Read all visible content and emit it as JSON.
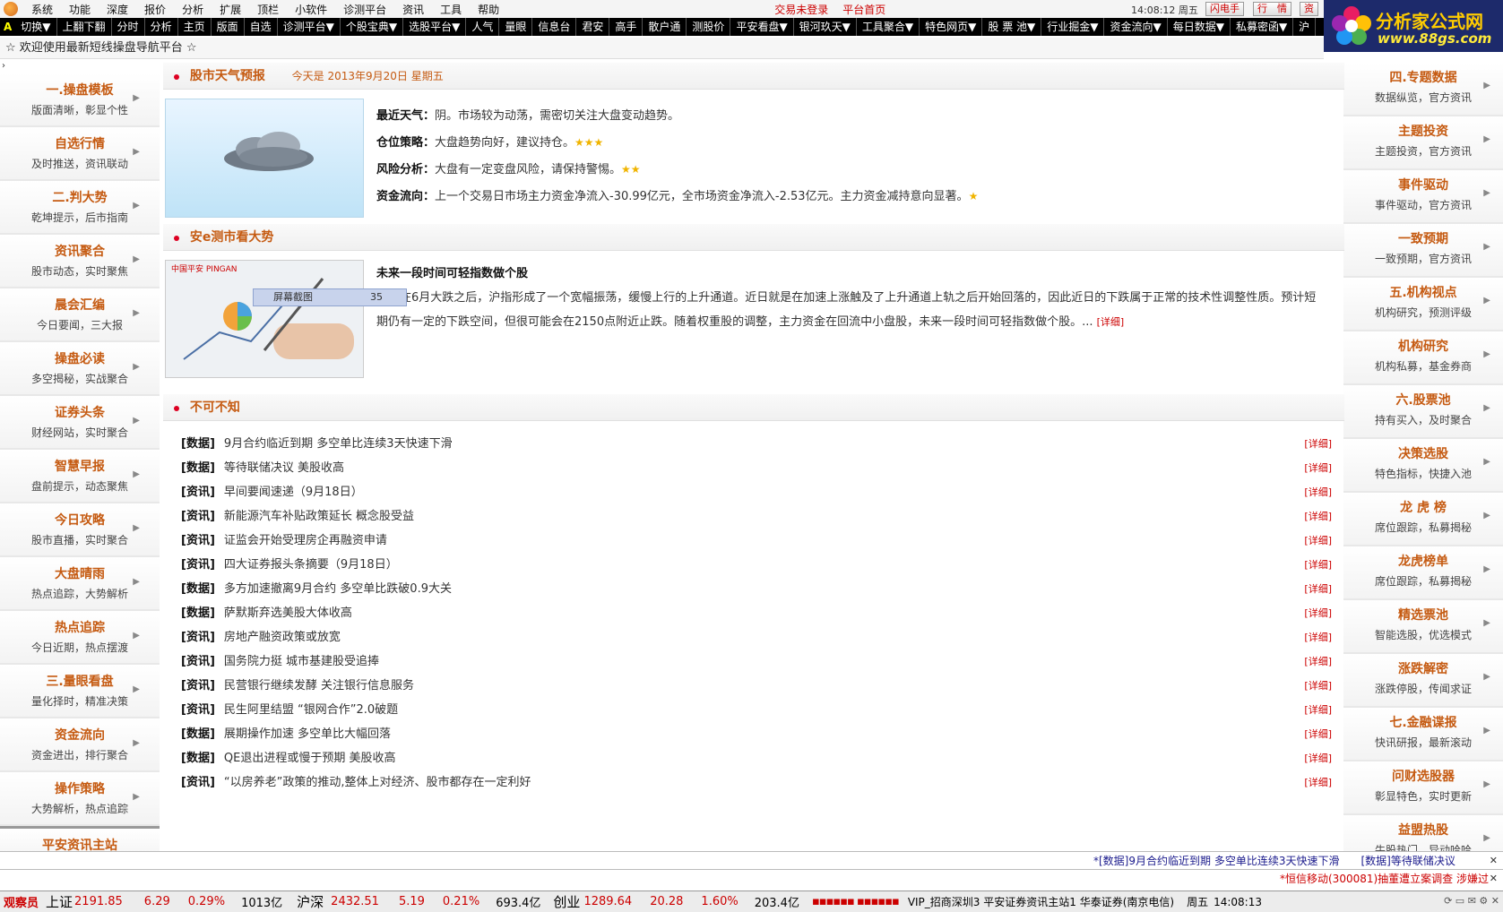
{
  "menubar": {
    "items": [
      "系统",
      "功能",
      "深度",
      "报价",
      "分析",
      "扩展",
      "顶栏",
      "小软件",
      "诊测平台",
      "资讯",
      "工具",
      "帮助"
    ],
    "status_login": "交易未登录",
    "status_home": "平台首页",
    "clock": "14:08:12 周五",
    "btn_flash": "闪电手",
    "btn_quote": "行　情",
    "btn_info": "资"
  },
  "toolbar": {
    "a_label": "A",
    "items": [
      "切换▼",
      "上翻下翻",
      "分时",
      "分析",
      "主页",
      "版面",
      "自选",
      "诊测平台▼",
      "个股宝典▼",
      "选股平台▼",
      "人气",
      "量眼",
      "信息台",
      "君安",
      "高手",
      "散户通",
      "测股价",
      "平安看盘▼",
      "银河玖天▼",
      "工具聚合▼",
      "特色网页▼",
      "股 票 池▼",
      "行业掘金▼",
      "资金流向▼",
      "每日数据▼",
      "私募密函▼",
      "沪"
    ]
  },
  "logo": {
    "title": "分析家公式网",
    "url": "www.88gs.com"
  },
  "welcome": "☆ 欢迎使用最新短线操盘导航平台 ☆",
  "left_nav": [
    {
      "t": "一.操盘模板",
      "s": "版面清晰，彰显个性"
    },
    {
      "t": "自选行情",
      "s": "及时推送，资讯联动"
    },
    {
      "t": "二.判大势",
      "s": "乾坤提示，后市指南"
    },
    {
      "t": "资讯聚合",
      "s": "股市动态，实时聚焦"
    },
    {
      "t": "晨会汇编",
      "s": "今日要闻，三大报"
    },
    {
      "t": "操盘必读",
      "s": "多空揭秘，实战聚合"
    },
    {
      "t": "证券头条",
      "s": "财经网站，实时聚合"
    },
    {
      "t": "智慧早报",
      "s": "盘前提示，动态聚焦"
    },
    {
      "t": "今日攻略",
      "s": "股市直播，实时聚合"
    },
    {
      "t": "大盘晴雨",
      "s": "热点追踪，大势解析"
    },
    {
      "t": "热点追踪",
      "s": "今日近期，热点摆渡"
    },
    {
      "t": "三.量眼看盘",
      "s": "量化择时，精准决策"
    },
    {
      "t": "资金流向",
      "s": "资金进出，排行聚合"
    },
    {
      "t": "操作策略",
      "s": "大势解析，热点追踪"
    }
  ],
  "left_last": "平安资讯主站",
  "right_nav": [
    {
      "t": "四.专题数据",
      "s": "数据纵览，官方资讯"
    },
    {
      "t": "主题投资",
      "s": "主题投资，官方资讯"
    },
    {
      "t": "事件驱动",
      "s": "事件驱动，官方资讯"
    },
    {
      "t": "一致预期",
      "s": "一致预期，官方资讯"
    },
    {
      "t": "五.机构视点",
      "s": "机构研究，预测评级"
    },
    {
      "t": "机构研究",
      "s": "机构私募，基金券商"
    },
    {
      "t": "六.股票池",
      "s": "持有买入，及时聚合"
    },
    {
      "t": "决策选股",
      "s": "特色指标，快捷入池"
    },
    {
      "t": "龙 虎 榜",
      "s": "席位跟踪，私募揭秘"
    },
    {
      "t": "龙虎榜单",
      "s": "席位跟踪，私募揭秘"
    },
    {
      "t": "精选票池",
      "s": "智能选股，优选模式"
    },
    {
      "t": "涨跌解密",
      "s": "涨跌停股，传闻求证"
    },
    {
      "t": "七.金融谍报",
      "s": "快讯研报，最新滚动"
    },
    {
      "t": "问财选股器",
      "s": "彰显特色，实时更新"
    },
    {
      "t": "益盟热股",
      "s": "牛股热门，异动哈哈"
    }
  ],
  "weather": {
    "section_title": "股市天气预报",
    "date_text": "今天是 2013年9月20日 星期五",
    "lines": [
      {
        "k": "最近天气：",
        "v": "阴。市场较为动荡，需密切关注大盘变动趋势。",
        "stars": ""
      },
      {
        "k": "仓位策略：",
        "v": "大盘趋势向好，建议持仓。",
        "stars": "★★★"
      },
      {
        "k": "风险分析：",
        "v": "大盘有一定变盘风险，请保持警惕。",
        "stars": "★★"
      },
      {
        "k": "资金流向：",
        "v": "上一个交易日市场主力资金净流入-30.99亿元，全市场资金净流入-2.53亿元。主力资金减持意向显著。",
        "stars": "★"
      }
    ]
  },
  "analysis": {
    "section_title": "安e测市看大势",
    "img_brand": "中国平安 PINGAN",
    "headline": "未来一段时间可轻指数做个股",
    "body": "在6月大跌之后，沪指形成了一个宽幅振荡，缓慢上行的上升通道。近日就是在加速上涨触及了上升通道上轨之后开始回落的，因此近日的下跌属于正常的技术性调整性质。预计短期仍有一定的下跌空间，但很可能会在2150点附近止跌。随着权重股的调整，主力资金在回流中小盘股，未来一段时间可轻指数做个股。... ",
    "more": "[详细]",
    "overlay_label": "屏幕截图",
    "overlay_num": "35"
  },
  "must_know": {
    "section_title": "不可不知",
    "detail_label": "[详细]",
    "items": [
      {
        "tag": "[数据]",
        "title": "9月合约临近到期 多空单比连续3天快速下滑"
      },
      {
        "tag": "[数据]",
        "title": "等待联储决议 美股收高"
      },
      {
        "tag": "[资讯]",
        "title": "早间要闻速递（9月18日）"
      },
      {
        "tag": "[资讯]",
        "title": "新能源汽车补贴政策延长 概念股受益"
      },
      {
        "tag": "[资讯]",
        "title": "证监会开始受理房企再融资申请"
      },
      {
        "tag": "[资讯]",
        "title": "四大证券报头条摘要（9月18日）"
      },
      {
        "tag": "[数据]",
        "title": "多方加速撤离9月合约 多空单比跌破0.9大关"
      },
      {
        "tag": "[数据]",
        "title": "萨默斯弃选美股大体收高"
      },
      {
        "tag": "[资讯]",
        "title": "房地产融资政策或放宽"
      },
      {
        "tag": "[资讯]",
        "title": "国务院力挺 城市基建股受追捧"
      },
      {
        "tag": "[资讯]",
        "title": "民营银行继续发酵 关注银行信息服务"
      },
      {
        "tag": "[资讯]",
        "title": "民生阿里结盟 “银网合作”2.0破题"
      },
      {
        "tag": "[数据]",
        "title": "展期操作加速 多空单比大幅回落"
      },
      {
        "tag": "[数据]",
        "title": "QE退出进程或慢于预期 美股收高"
      },
      {
        "tag": "[资讯]",
        "title": "“以房养老”政策的推动,整体上对经济、股市都存在一定利好"
      }
    ]
  },
  "ticker1": "*[数据]9月合约临近到期 多空单比连续3天快速下滑　　[数据]等待联储决议",
  "ticker2": "*恒信移动(300081)抽董遭立案调查 涉嫌过",
  "statusbar": {
    "observer": "观察员",
    "sh_name": "上证",
    "sh_val": "2191.85",
    "sh_chg": "6.29",
    "sh_pct": "0.29%",
    "sh_vol": "1013亿",
    "sz_name": "沪深",
    "sz_val": "2432.51",
    "sz_chg": "5.19",
    "sz_pct": "0.21%",
    "sz_vol": "693.4亿",
    "cy_name": "创业",
    "cy_val": "1289.64",
    "cy_chg": "20.28",
    "cy_pct": "1.60%",
    "cy_vol": "203.4亿",
    "bars": "▪▪▪▪▪▪ ▪▪▪▪▪▪",
    "server": "VIP_招商深圳3  平安证券资讯主站1  华泰证券(南京电信)",
    "weekday": "周五",
    "time": "14:08:13"
  },
  "colors": {
    "accent": "#c55a11",
    "up": "#cc0000",
    "menubar_bg": "#f4f4f4",
    "toolbar_bg": "#000000"
  }
}
